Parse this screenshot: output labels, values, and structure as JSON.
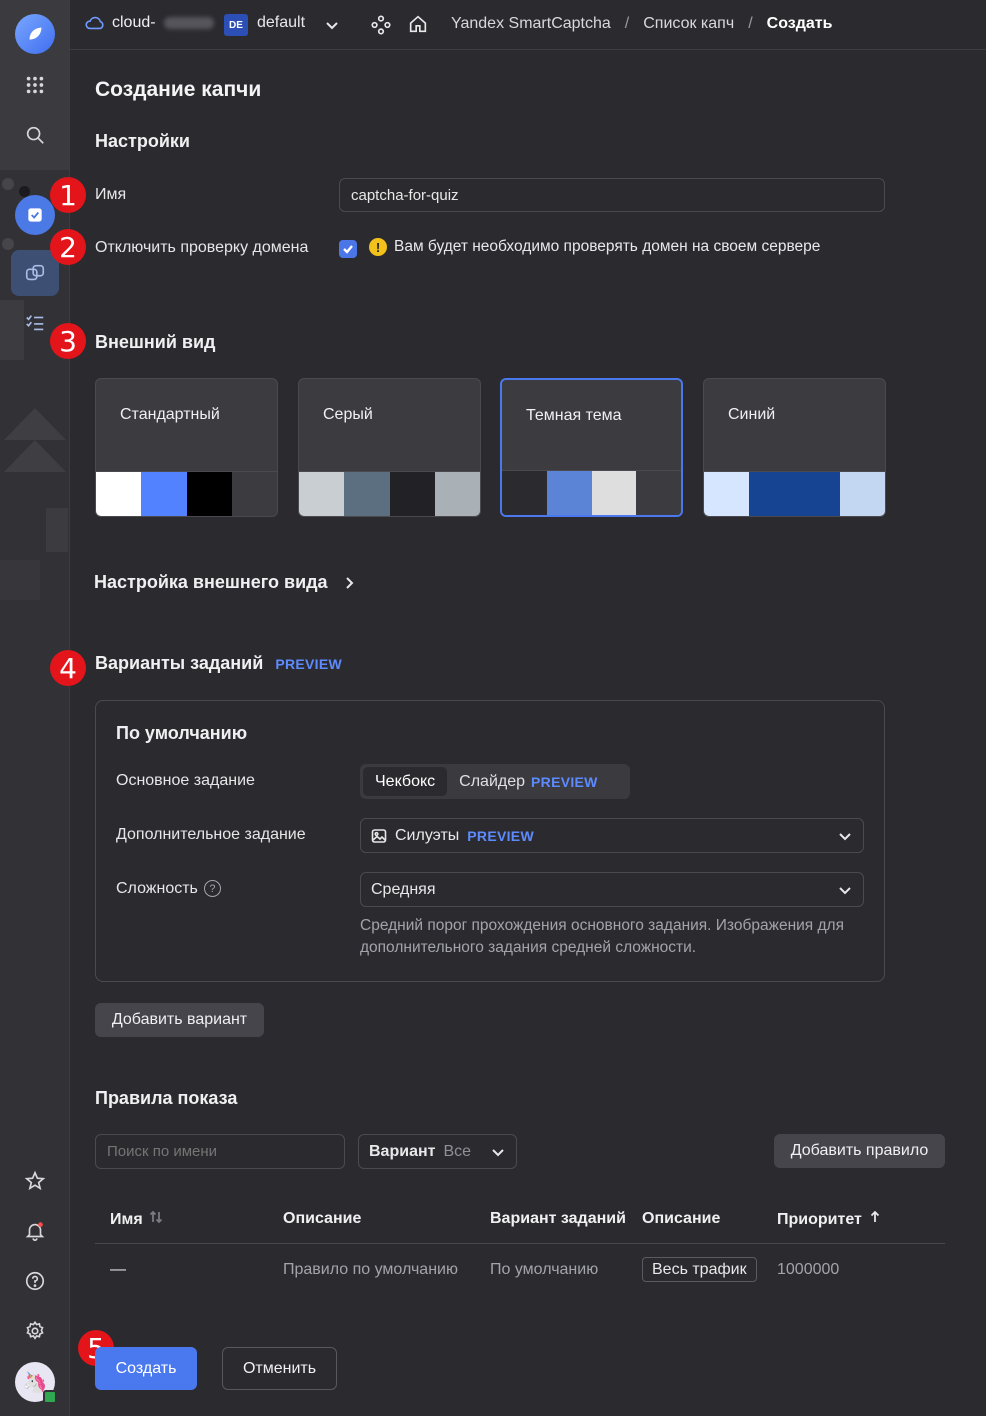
{
  "header": {
    "cloud_name": "cloud-",
    "folder_badge": "DE",
    "folder_name": "default",
    "breadcrumbs": [
      "Yandex SmartCaptcha",
      "Список капч",
      "Создать"
    ]
  },
  "markers": [
    "1",
    "2",
    "3",
    "4",
    "5"
  ],
  "page": {
    "title": "Создание капчи",
    "settings_title": "Настройки",
    "name_label": "Имя",
    "name_value": "captcha-for-quiz",
    "domain_check_label": "Отключить проверку домена",
    "domain_check_checked": true,
    "domain_warning": "Вам будет необходимо проверять домен на своем сервере"
  },
  "appearance": {
    "title": "Внешний вид",
    "themes": [
      {
        "name": "Стандартный",
        "selected": false,
        "colors": [
          "#ffffff",
          "#5282ff",
          "#000000",
          "#3b3b40"
        ]
      },
      {
        "name": "Серый",
        "selected": false,
        "colors": [
          "#c9ced3",
          "#5b6f80",
          "#222226",
          "#a9b0b6"
        ]
      },
      {
        "name": "Темная тема",
        "selected": true,
        "colors": [
          "#2b2b2f",
          "#5b84d6",
          "#dedede",
          "#3b3b40"
        ]
      },
      {
        "name": "Синий",
        "selected": false,
        "colors": [
          "#d6e6ff",
          "#164493",
          "#164493",
          "#c3d6f2"
        ]
      }
    ],
    "customize_link": "Настройка внешнего вида"
  },
  "tasks": {
    "title": "Варианты заданий",
    "title_badge": "PREVIEW",
    "box_title": "По умолчанию",
    "main_task_label": "Основное задание",
    "main_task_options": [
      {
        "label": "Чекбокс",
        "selected": true,
        "badge": ""
      },
      {
        "label": "Слайдер",
        "selected": false,
        "badge": "PREVIEW"
      }
    ],
    "extra_task_label": "Дополнительное задание",
    "extra_task_value": "Силуэты",
    "extra_task_badge": "PREVIEW",
    "difficulty_label": "Сложность",
    "difficulty_value": "Средняя",
    "difficulty_hint": "Средний порог прохождения основного задания. Изображения для дополнительного задания средней сложности.",
    "add_variant_button": "Добавить вариант"
  },
  "rules": {
    "title": "Правила показа",
    "search_placeholder": "Поиск по имени",
    "variant_filter_label": "Вариант",
    "variant_filter_value": "Все",
    "add_rule_button": "Добавить правило",
    "columns": [
      "Имя",
      "Описание",
      "Вариант заданий",
      "Описание",
      "Приоритет"
    ],
    "rows": [
      {
        "name": "—",
        "description": "Правило по умолчанию",
        "variant": "По умолчанию",
        "condition": "Весь трафик",
        "priority": "1000000"
      }
    ]
  },
  "footer": {
    "create_button": "Создать",
    "cancel_button": "Отменить"
  },
  "colors": {
    "accent": "#4a78ef",
    "preview": "#5d8bff",
    "marker": "#e3151a",
    "warning": "#f2c21b"
  }
}
